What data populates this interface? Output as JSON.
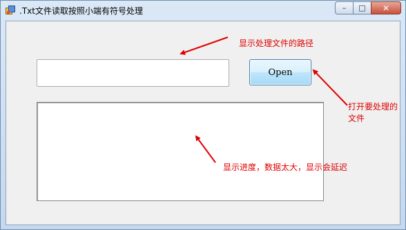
{
  "window": {
    "title": ".Txt文件读取按照小端有符号处理",
    "minimize_glyph": "–",
    "maximize_glyph": "□",
    "close_glyph": "✕"
  },
  "form": {
    "path_input_value": "",
    "open_button_label": "Open",
    "progress_text": ""
  },
  "annotations": {
    "path_label": "显示处理文件的路径",
    "open_label_line1": "打开要处理的",
    "open_label_line2": "文件",
    "progress_label": "显示进度，数据太大，显示会延迟",
    "color": "#e00000"
  },
  "icons": {
    "app": "app-icon",
    "arrows": "red-arrow-icon"
  }
}
